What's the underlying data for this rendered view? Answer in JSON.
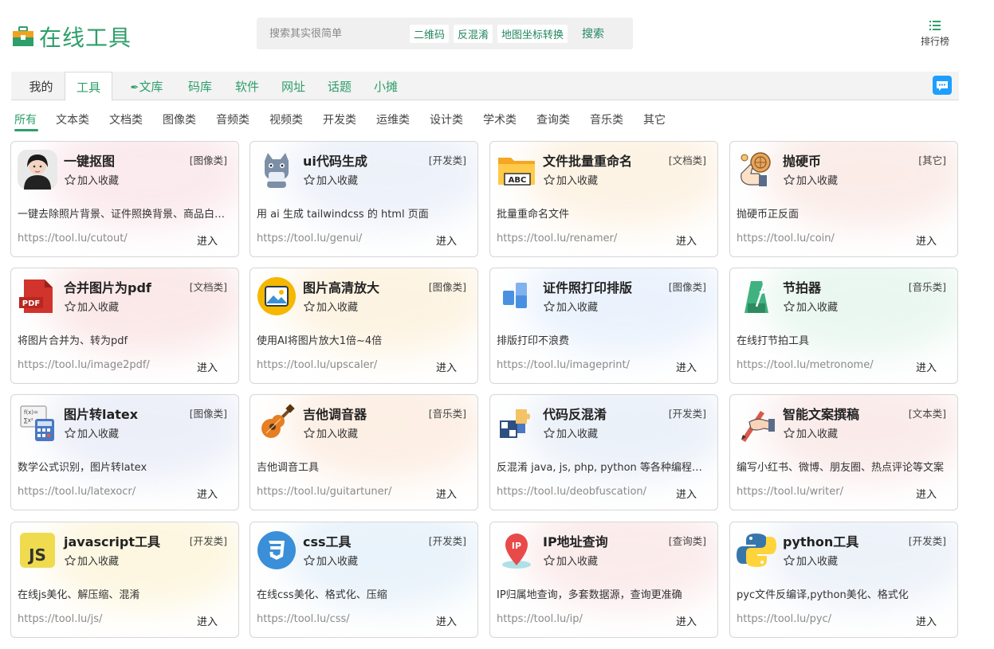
{
  "header": {
    "site_title": "在线工具",
    "search_placeholder": "搜索其实很简单",
    "search_tags": [
      "二维码",
      "反混淆",
      "地图坐标转换"
    ],
    "search_button": "搜索",
    "ranking_label": "排行榜"
  },
  "main_nav": {
    "items": [
      "我的",
      "工具",
      "文库",
      "码库",
      "软件",
      "网址",
      "话题",
      "小摊"
    ],
    "active": "工具"
  },
  "sub_nav": {
    "items": [
      "所有",
      "文本类",
      "文档类",
      "图像类",
      "音频类",
      "视频类",
      "开发类",
      "运维类",
      "设计类",
      "学术类",
      "查询类",
      "音乐类",
      "其它"
    ],
    "active": "所有"
  },
  "fav_label": "加入收藏",
  "enter_label": "进入",
  "cards": [
    {
      "title": "一键抠图",
      "category": "[图像类]",
      "desc": "一键去除照片背景、证件照换背景、商品白…",
      "url": "https://tool.lu/cutout/",
      "icon": "portrait-photo-icon",
      "glow": "#f7d9e0"
    },
    {
      "title": "ui代码生成",
      "category": "[开发类]",
      "desc": "用 ai 生成 tailwindcss 的 html 页面",
      "url": "https://tool.lu/genui/",
      "icon": "cat-mascot-icon",
      "glow": "#dfe7f5"
    },
    {
      "title": "文件批量重命名",
      "category": "[文档类]",
      "desc": "批量重命名文件",
      "url": "https://tool.lu/renamer/",
      "icon": "folder-abc-icon",
      "glow": "#fbe9cf"
    },
    {
      "title": "抛硬币",
      "category": "[其它]",
      "desc": "抛硬币正反面",
      "url": "https://tool.lu/coin/",
      "icon": "coin-flip-icon",
      "glow": "#f7ddd6"
    },
    {
      "title": "合并图片为pdf",
      "category": "[文档类]",
      "desc": "将图片合并为、转为pdf",
      "url": "https://tool.lu/image2pdf/",
      "icon": "pdf-file-icon",
      "glow": "#f8d6d6"
    },
    {
      "title": "图片高清放大",
      "category": "[图像类]",
      "desc": "使用AI将图片放大1倍~4倍",
      "url": "https://tool.lu/upscaler/",
      "icon": "image-frame-icon",
      "glow": "#fbeacb"
    },
    {
      "title": "证件照打印排版",
      "category": "[图像类]",
      "desc": "排版打印不浪费",
      "url": "https://tool.lu/imageprint/",
      "icon": "layout-blocks-icon",
      "glow": "#dbe8fb"
    },
    {
      "title": "节拍器",
      "category": "[音乐类]",
      "desc": "在线打节拍工具",
      "url": "https://tool.lu/metronome/",
      "icon": "metronome-icon",
      "glow": "#d9f1e4"
    },
    {
      "title": "图片转latex",
      "category": "[图像类]",
      "desc": "数学公式识别，图片转latex",
      "url": "https://tool.lu/latexocr/",
      "icon": "formula-calculator-icon",
      "glow": "#dde3f3"
    },
    {
      "title": "吉他调音器",
      "category": "[音乐类]",
      "desc": "吉他调音工具",
      "url": "https://tool.lu/guitartuner/",
      "icon": "guitar-icon",
      "glow": "#fbe2cf"
    },
    {
      "title": "代码反混淆",
      "category": "[开发类]",
      "desc": "反混淆 java, js, php, python 等各种编程…",
      "url": "https://tool.lu/deobfuscation/",
      "icon": "puzzle-icon",
      "glow": "#dce6f4"
    },
    {
      "title": "智能文案撰稿",
      "category": "[文本类]",
      "desc": "编写小红书、微博、朋友圈、热点评论等文案",
      "url": "https://tool.lu/writer/",
      "icon": "hand-pen-icon",
      "glow": "#f6dcd9"
    },
    {
      "title": "javascript工具",
      "category": "[开发类]",
      "desc": "在线js美化、解压缩、混淆",
      "url": "https://tool.lu/js/",
      "icon": "js-logo-icon",
      "glow": "#fbf0c8"
    },
    {
      "title": "css工具",
      "category": "[开发类]",
      "desc": "在线css美化、格式化、压缩",
      "url": "https://tool.lu/css/",
      "icon": "css-logo-icon",
      "glow": "#d8e9f7"
    },
    {
      "title": "IP地址查询",
      "category": "[查询类]",
      "desc": "IP归属地查询，多套数据源，查询更准确",
      "url": "https://tool.lu/ip/",
      "icon": "ip-location-pin-icon",
      "glow": "#f8dcdc"
    },
    {
      "title": "python工具",
      "category": "[开发类]",
      "desc": "pyc文件反编译,python美化、格式化",
      "url": "https://tool.lu/pyc/",
      "icon": "python-logo-icon",
      "glow": "#dfe8f5"
    }
  ]
}
